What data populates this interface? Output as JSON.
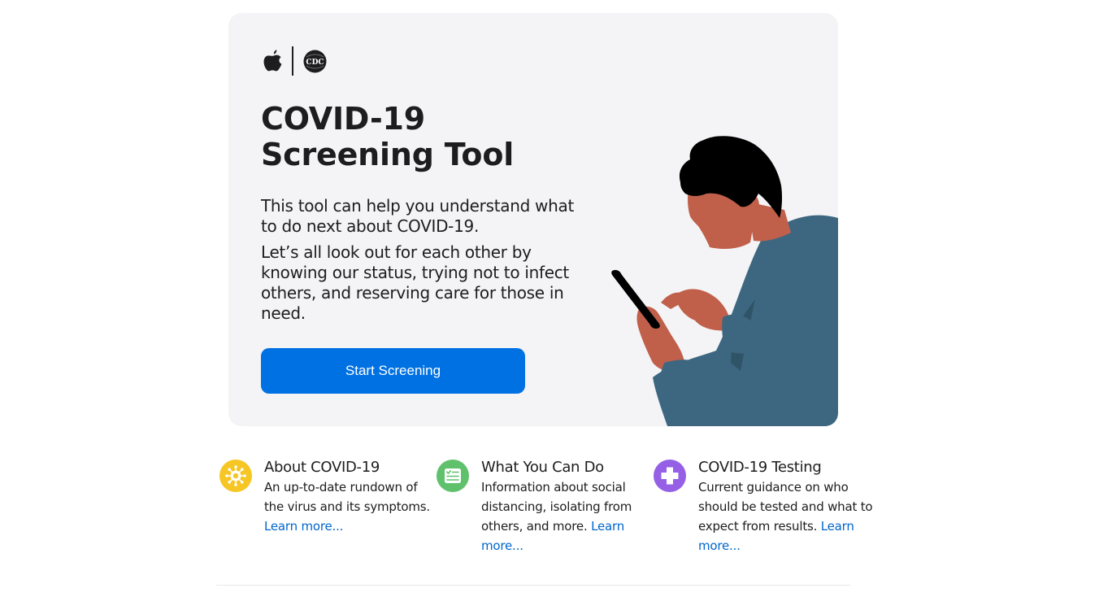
{
  "hero": {
    "title_line1": "COVID-19",
    "title_line2": "Screening Tool",
    "description1": "This tool can help you understand what to do next about COVID-19.",
    "description2": "Let’s all look out for each other by knowing our status, trying not to infect others, and reserving care for those in need.",
    "start_button": "Start Screening",
    "logos": {
      "left": "apple-logo",
      "right": "cdc-logo"
    },
    "cdc_logo_text": "CDC"
  },
  "features": [
    {
      "title": "About COVID-19",
      "text": "An up-to-date rundown of the virus and its symptoms.",
      "link": "Learn more...",
      "icon": "virus-icon",
      "color": "#f6c624"
    },
    {
      "title": "What You Can Do",
      "text": "Information about social distancing, isolating from others, and more.",
      "link": "Learn more...",
      "icon": "checklist-icon",
      "color": "#5fc16c"
    },
    {
      "title": "COVID-19 Testing",
      "text": "Current guidance on who should be tested and what to expect from results.",
      "link": "Learn more...",
      "icon": "medical-cross-icon",
      "color": "#9560e6"
    }
  ],
  "colors": {
    "accent": "#0071e3",
    "link": "#0066cc",
    "hero_background": "#f4f4f6",
    "skin": "#c0604a",
    "shirt": "#3d6780",
    "hair": "#000000"
  }
}
